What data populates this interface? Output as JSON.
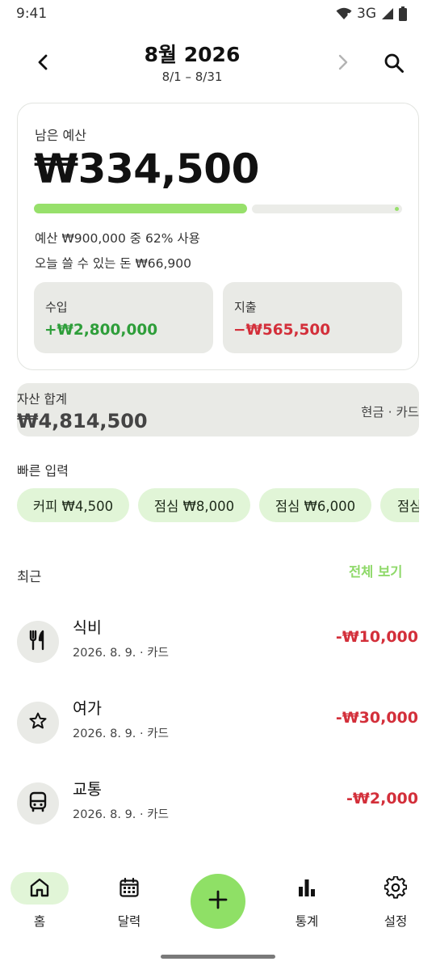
{
  "status_bar": {
    "time": "9:41",
    "network": "3G"
  },
  "header": {
    "title": "8월 2026",
    "date_range": "8/1 – 8/31"
  },
  "budget": {
    "label": "남은 예산",
    "remaining": "₩334,500",
    "used_fraction": 0.62,
    "summary": "예산 ₩900,000 중 62% 사용",
    "daily_allowance": "오늘 쓸 수 있는 돈 ₩66,900",
    "income": {
      "label": "수입",
      "value": "+₩2,800,000"
    },
    "expense": {
      "label": "지출",
      "value": "−₩565,500"
    }
  },
  "assets": {
    "label": "자산 합계",
    "value": "₩4,814,500",
    "meta": "현금 · 카드"
  },
  "quick_input": {
    "title": "빠른 입력",
    "chips": [
      {
        "label": "커피 ₩4,500"
      },
      {
        "label": "점심 ₩8,000"
      },
      {
        "label": "점심 ₩6,000"
      },
      {
        "label": "점심"
      }
    ]
  },
  "recent": {
    "title": "최근",
    "see_all": "전체 보기",
    "items": [
      {
        "category": "식비",
        "meta": "2026. 8. 9. · 카드",
        "amount": "-₩10,000",
        "icon": "utensils-icon"
      },
      {
        "category": "여가",
        "meta": "2026. 8. 9. · 카드",
        "amount": "-₩30,000",
        "icon": "star-icon"
      },
      {
        "category": "교통",
        "meta": "2026. 8. 9. · 카드",
        "amount": "-₩2,000",
        "icon": "bus-icon"
      }
    ]
  },
  "nav": {
    "home": "홈",
    "calendar": "달력",
    "stats": "통계",
    "settings": "설정"
  },
  "colors": {
    "accent": "#8fe066",
    "income": "#2e9e3a",
    "expense": "#d32f3a",
    "chip_bg": "#e1f5d7",
    "card_bg": "#e9eae6"
  }
}
